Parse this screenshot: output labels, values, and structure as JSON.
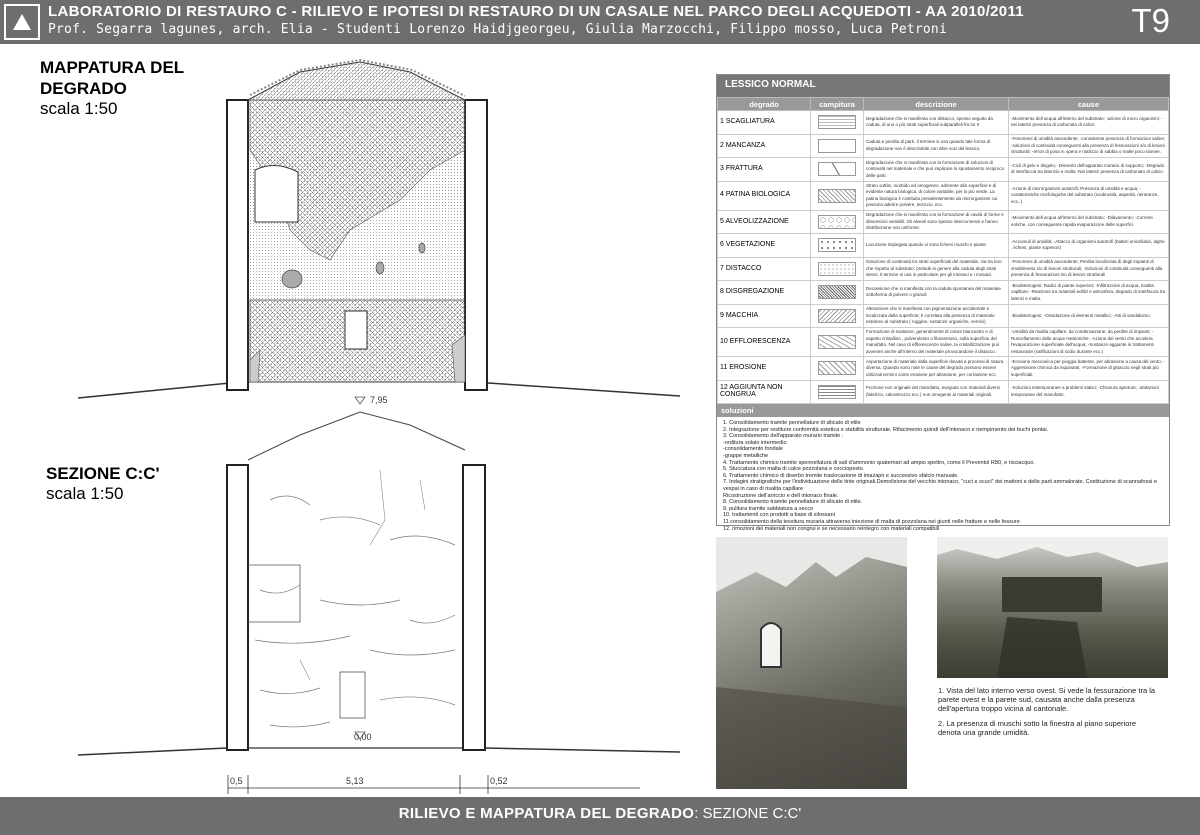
{
  "header": {
    "title": "LABORATORIO DI RESTAURO C - RILIEVO E IPOTESI DI RESTAURO DI UN CASALE NEL PARCO DEGLI ACQUEDOTI - AA 2010/2011",
    "subtitle": "Prof. Segarra lagunes, arch. Elia - Studenti Lorenzo Haidjgeorgeu, Giulia Marzocchi, Filippo mosso, Luca Petroni",
    "code": "T9"
  },
  "section1": {
    "title_line1": "MAPPATURA DEL",
    "title_line2": "DEGRADO",
    "scale": "scala 1:50"
  },
  "section2": {
    "title": "SEZIONE C:C'",
    "scale": "scala 1:50"
  },
  "elevations": {
    "top": "7,95",
    "bottom": "0,00"
  },
  "dimensions": {
    "left": "0,5",
    "middle": "5,13",
    "right": "0,52"
  },
  "legend": {
    "title": "LESSICO NORMAL",
    "headers": {
      "degrado": "degrado",
      "campitura": "campitura",
      "descrizione": "descrizione",
      "cause": "cause"
    },
    "rows": [
      {
        "name": "1 SCAGLIATURA",
        "desc": "Degradazione che si manifesta con distacco, spesso seguito da caduta, di uno o più strati superficiali subparalleli fra lor 0",
        "cause": "-Movimento dell acqua all'interno del substrato; -azione di micro organismi; -nei laterizi presenza di carbonato di calcio"
      },
      {
        "name": "2 MANCANZA",
        "desc": "Caduta e perdita di parti. Il termine si usa quando tale forma di degradazione non è descrivibile con altre voci del lessico.",
        "cause": "-Fenomeni di umidità ascendente; -consistente presenza di formazioni saline; -soluzioni di continuità conseguenti alla presenza di fessurazioni s/o di lesioni strutturali; -errori di posa in opera e riutilizzo di sabbia o malte poco idonee."
      },
      {
        "name": "3 FRATTURA",
        "desc": "Degradazione che si manifesta con la formazione di soluzioni di continuità nel materiale e che può implicare lo spostamento reciproco delle parti.",
        "cause": "-Cicli di gelo e disgelo; -Dissesto dell'apparato murario di supporto; -Degrado di interfaccia tra laterizio e malta -Nei laterizi presenza di carbonato di calcio."
      },
      {
        "name": "4 PATINA BIOLOGICA",
        "desc": "Strato sottile, morbido ed omogeneo, aderente alla superficie e di evidente natura biologica, di colore variabile, per lo più verde. La patina biologica è costituita prevalentemente da microrganismi cui possono aderire polvere, terriccio, ecc.",
        "cause": "-Azione di microrganismi autotrofi; Presenza di umidità e acqua; -caratteristiche morfologiche del substrato (scabrosità, asperità, rientranze, ecc..)"
      },
      {
        "name": "5 ALVEOLIZZAZIONE",
        "desc": "Degradazione che si manifesta con la formazione di cavità di forme e dimensioni variabili. Gli alveoli sono spesso interconnessi e hanno distribuzione non uniforme.",
        "cause": "-Movimento dell acqua all'interno del substrato; -Dilavamento; -Correnti eoliche, con conseguente rapida evaporazione delle superfici"
      },
      {
        "name": "6 VEGETAZIONE",
        "desc": "Locuzione impiegata quando vi sono licheni muschi e piante",
        "cause": "-Accumuli di umidità; -Attacco di organismi autotrofi (batteri unicellulari, alghe , licheni, piante superiori)"
      },
      {
        "name": "7 DISTACCO",
        "desc": "Soluzione di continuità tra strati superficiali del materiale, sia tra loro che rispetto al substrato: prelude in genere alla caduta degli strati stessi. Il termine si usa in particolare per gli intonaci e i mosaici.",
        "cause": "-Fenomeni di umidità ascendente; Perdita localizzata di degli impianti di smaltimento s/o di lesioni strutturali; -Soluzioni di continuità conseguenti alla presenza di fessurazioni s/o di lesioni strutturali"
      },
      {
        "name": "8 DISGREGAZIONE",
        "desc": "Decoesione che si manifesta con la caduta spontanea del materiale sottoforma di polvere o granuli",
        "cause": "-Biodeteriogeni; Radici di piante superiori; -Infiltrazione di acqua, risalita capillare; -Reazione tra materiali edilizi e atmosfera, degrado di interfaccia tra laterizi e malta."
      },
      {
        "name": "9 MACCHIA",
        "desc": "Alterazione che si manifesta con pigmentazione accidentale e localizzata della superficie; è correlata alla presenza di materiale estraneo al substrato ( ruggine, sostanze organiche, vernici)",
        "cause": "-Biodeteriogeni; -Ossidazione di elementi metallici; -Atti di vandalismo."
      },
      {
        "name": "10 EFFLORESCENZA",
        "desc": "Formazione di sostanze, generalmente di colore biancastro e di aspetto cristallino , pulverulento o filamentoso, sulla superficie del manufatto. Nel caso di efflorescenze saline, la cristallizzazione può avvenire anche all'interno del materiale provocandone il distacco.",
        "cause": "-Umidità da risalita capillare, da condensazione, da perdite di impianti; -Ruscellamento delle acque meteoriche; -Azione del vento che accelera l'evaporazione superficiale dell'acqua; -Sostanze aggiunte in trattamenti restaurativi (salificazioni di sodio durante ecc.)"
      },
      {
        "name": "11 EROSIONE",
        "desc": "Asportazione di materiale dalla superficie dovuta a processi di natura diversa. Quando sono note le cause del degrado possono essere utilizzati termini come erosione per abrasione, per corrasione ecc.",
        "cause": "-Erosione meccanica per pioggia battente, per abrasione a causa del vento; -Aggressione chimica da inquinanti; -Formazione di ghiaccio negli strati più superficiali."
      },
      {
        "name": "12 AGGIUNTA NON CONGRUA",
        "desc": "Porzione non originale del manufatto, eseguita con materiali diversi (laterizio, calcestruzzo ecc.) non omogenei ai materiali originali.",
        "cause": "-Soluzioni estemporanee a problemi statici; -Chiusura aperture; -abitazioni temporanee del manufatto."
      }
    ],
    "solutions_title": "soluzioni",
    "solutions": [
      "1. Consolidamento tramite pennellature di silicato di etile",
      "2. Integrazione per restituire conformità estetica e stabilità strutturale. Rifacimento quindi dell'intonaco e riempimento dei buchi pontai.",
      "3. Consolidamento dell'apparato murario tramite :",
      "-orditura solaio intermedio",
      "-consolidamento fondale",
      "-grappe metalliche",
      "4. Trattamento chimico tramite spennellatura di sali d'ammonio quaternari ad ampio spettro, come il Preventol R80, e risciacquo.",
      "5. Stuccatura con malta di calce pozzolana e cocciopesto.",
      "6. Trattamento chimico di diserbo tremite traslocazione di imazapir e successivo sfalcio manuale.",
      "7. Indagini stratigrafiche per l'individuazione delle tinte originali.Demolizione del vecchio intonaco, \"cuci e scuci\" dei mattoni e delle parti ammalorate. Costituzione di scannafossi e vespai in caso di risalita capillare",
      "Ricostruzione dell'arriccio e dell intonaco finale.",
      "8. Consolidamento tramite pennellature di silicato di etile.",
      "9. pulitura tramite sabbiatura a secco",
      "10. trattamenti con prodotti a base di silossani",
      "11.consolidamento della tessitura muraria attraverso iniezione di malta di pozzolana nei giunti nelle fratture e nelle fessure",
      "12. rimozioni dei materiali non congrui e se necessario reintegro con materiali compatibili"
    ]
  },
  "photos": {
    "photo1_num": "1",
    "photo2_num": "2"
  },
  "captions": {
    "c1": "1. Vista del lato interno verso ovest. Si vede la fessurazione tra la parete ovest e la parete sud, causata anche dalla presenza dell'apertura troppo vicina al cantonale.",
    "c2": "2. La presenza di muschi sotto la finestra al piano superiore denota una grande umidità."
  },
  "footer": {
    "bold": "RILIEVO E MAPPATURA DEL DEGRADO",
    "rest": ": SEZIONE C:C'"
  }
}
